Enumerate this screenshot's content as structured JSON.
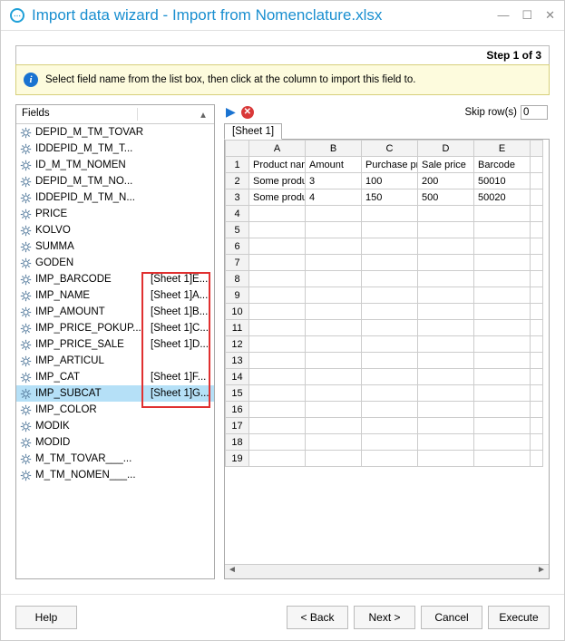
{
  "window": {
    "title": "Import data wizard - Import from Nomenclature.xlsx"
  },
  "step_label": "Step 1 of 3",
  "hint_text": "Select field name from the list box, then click at the column to import this field to.",
  "fields_panel": {
    "header": "Fields",
    "selected": "IMP_SUBCAT",
    "items": [
      {
        "name": "DEPID_M_TM_TOVAR",
        "map": ""
      },
      {
        "name": "IDDEPID_M_TM_T...",
        "map": ""
      },
      {
        "name": "ID_M_TM_NOMEN",
        "map": ""
      },
      {
        "name": "DEPID_M_TM_NO...",
        "map": ""
      },
      {
        "name": "IDDEPID_M_TM_N...",
        "map": ""
      },
      {
        "name": "PRICE",
        "map": ""
      },
      {
        "name": "KOLVO",
        "map": ""
      },
      {
        "name": "SUMMA",
        "map": ""
      },
      {
        "name": "GODEN",
        "map": ""
      },
      {
        "name": "IMP_BARCODE",
        "map": "[Sheet 1]E..."
      },
      {
        "name": "IMP_NAME",
        "map": "[Sheet 1]A..."
      },
      {
        "name": "IMP_AMOUNT",
        "map": "[Sheet 1]B..."
      },
      {
        "name": "IMP_PRICE_POKUP...",
        "map": "[Sheet 1]C..."
      },
      {
        "name": "IMP_PRICE_SALE",
        "map": "[Sheet 1]D..."
      },
      {
        "name": "IMP_ARTICUL",
        "map": ""
      },
      {
        "name": "IMP_CAT",
        "map": "[Sheet 1]F..."
      },
      {
        "name": "IMP_SUBCAT",
        "map": "[Sheet 1]G..."
      },
      {
        "name": "IMP_COLOR",
        "map": ""
      },
      {
        "name": "MODIK",
        "map": ""
      },
      {
        "name": "MODID",
        "map": ""
      },
      {
        "name": "M_TM_TOVAR___...",
        "map": ""
      },
      {
        "name": "M_TM_NOMEN___...",
        "map": ""
      }
    ]
  },
  "skip_rows": {
    "label": "Skip row(s)",
    "value": "0"
  },
  "sheet_tab": "[Sheet 1]",
  "grid": {
    "columns": [
      "A",
      "B",
      "C",
      "D",
      "E"
    ],
    "headers_row": [
      "Product name",
      "Amount",
      "Purchase pric",
      "Sale price",
      "Barcode"
    ],
    "data": [
      [
        "Some produc",
        "3",
        "100",
        "200",
        "50010"
      ],
      [
        "Some produc",
        "4",
        "150",
        "500",
        "50020"
      ]
    ],
    "visible_rows": 19
  },
  "buttons": {
    "help": "Help",
    "back": "< Back",
    "next": "Next >",
    "cancel": "Cancel",
    "execute": "Execute"
  }
}
